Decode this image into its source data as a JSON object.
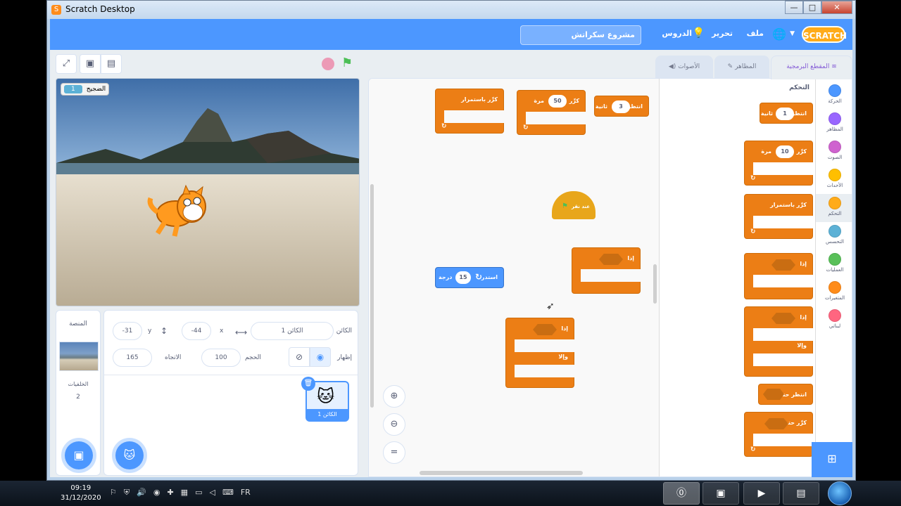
{
  "window": {
    "title": "Scratch Desktop",
    "minimize": "—",
    "maximize": "□",
    "close": "✕"
  },
  "menubar": {
    "logo": "SCRATCH",
    "file": "ملف",
    "edit": "تحرير",
    "tutorials": "الدروس",
    "project_title": "مشروع سكراتش"
  },
  "tabs": {
    "code": "المقطع البرمجية",
    "costumes": "المظاهر",
    "sounds": "الأصوات"
  },
  "stage": {
    "variable_name": "الضجيج",
    "variable_value": "1"
  },
  "sprite_info": {
    "sprite_label": "الكائن",
    "sprite_name": "الكائن 1",
    "x_label": "x",
    "x_value": "-44",
    "y_label": "y",
    "y_value": "-31",
    "show_label": "إظهار",
    "size_label": "الحجم",
    "size_value": "100",
    "direction_label": "الاتجاه",
    "direction_value": "165",
    "sprite_thumb_label": "الكائن 1"
  },
  "stage_pane": {
    "title": "المنصة",
    "backdrops_label": "الخلفيات",
    "backdrops_count": "2"
  },
  "categories": [
    {
      "label": "الحركة",
      "color": "#4c97ff"
    },
    {
      "label": "المظاهر",
      "color": "#9966ff"
    },
    {
      "label": "الصوت",
      "color": "#cf63cf"
    },
    {
      "label": "الأحداث",
      "color": "#ffbf00"
    },
    {
      "label": "التحكم",
      "color": "#ffab19"
    },
    {
      "label": "التحسس",
      "color": "#5cb1d6"
    },
    {
      "label": "العمليات",
      "color": "#59c059"
    },
    {
      "label": "المتغيرات",
      "color": "#ff8c1a"
    },
    {
      "label": "لبناتي",
      "color": "#ff6680"
    }
  ],
  "flyout": {
    "title": "التحكم",
    "wait_text": "انتظر",
    "wait_value": "1",
    "seconds": "ثانية",
    "repeat_text": "كرِّر",
    "repeat_value": "10",
    "times": "مرة",
    "forever": "كرِّر باستمرار",
    "if": "إذا",
    "else": "وإلا",
    "wait_until": "انتظر حتى",
    "repeat_until": "كرِّر حتى"
  },
  "workspace": {
    "forever": "كرِّر باستمرار",
    "repeat_text": "كرِّر",
    "repeat_value": "50",
    "times": "مرة",
    "wait_text": "انتظر",
    "wait_value": "3",
    "seconds": "ثانية",
    "hat": "عند نقر",
    "if": "إذا",
    "else": "وإلا",
    "turn_text": "استدر",
    "turn_value": "15",
    "degrees": "درجة"
  },
  "taskbar": {
    "time": "09:19",
    "date": "31/12/2020",
    "lang": "FR"
  }
}
